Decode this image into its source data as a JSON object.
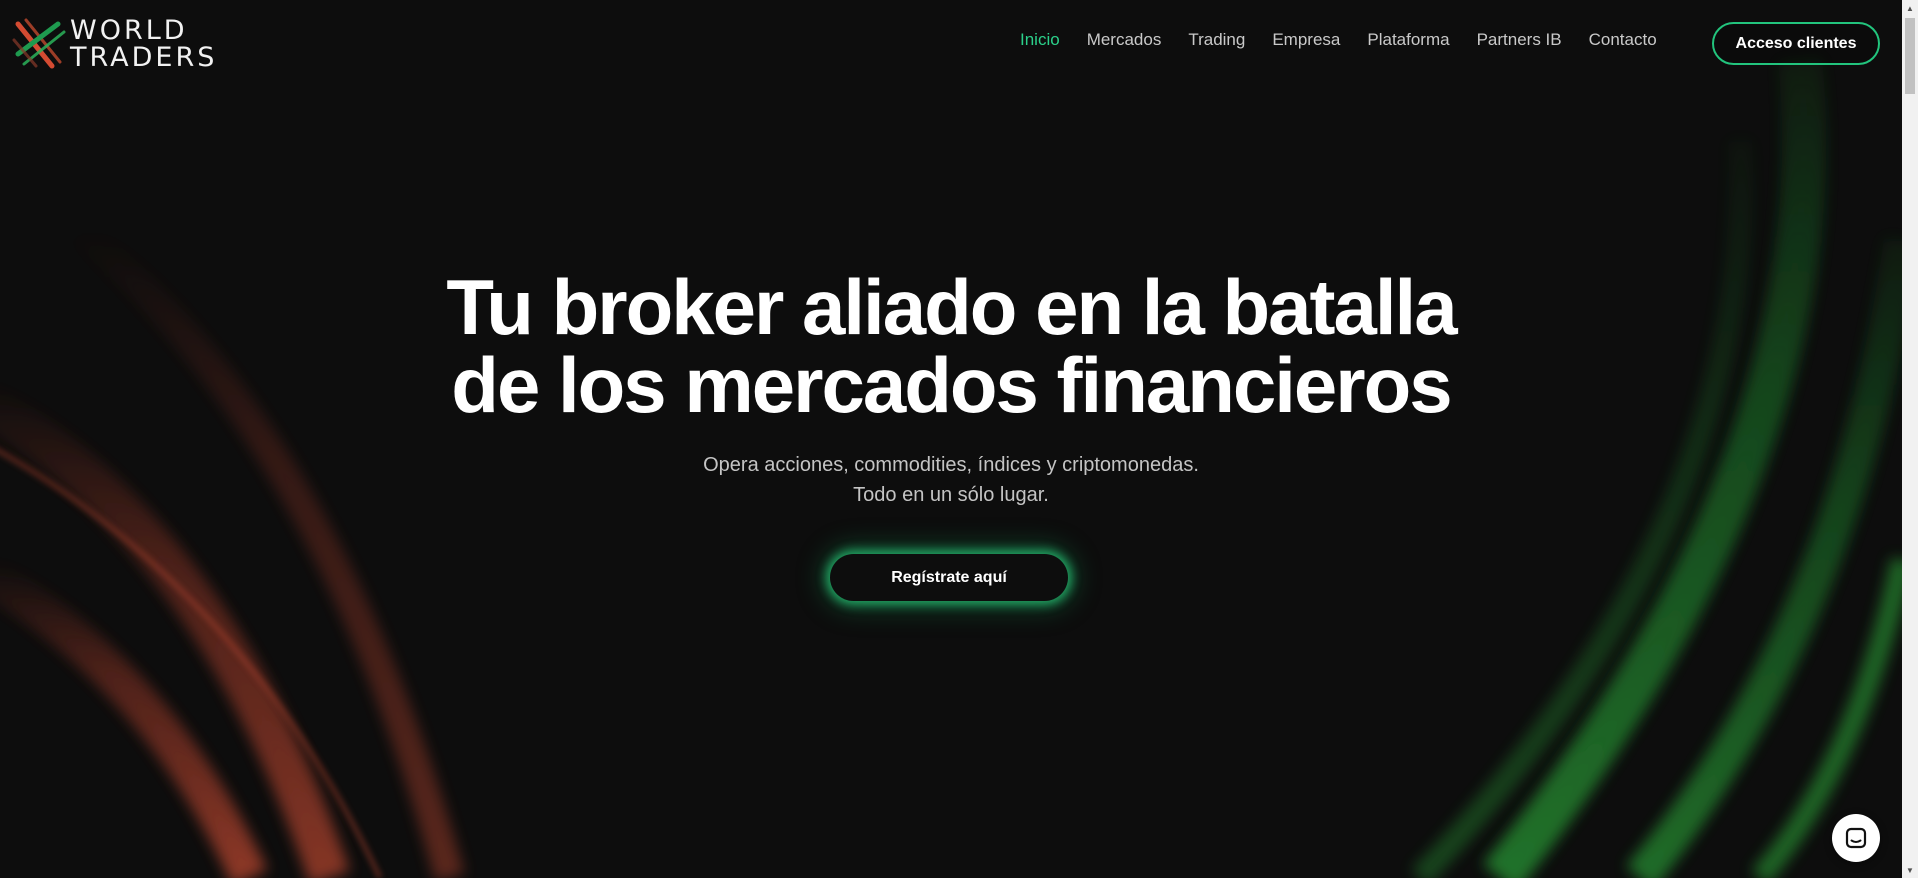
{
  "brand": {
    "line1": "WORLD",
    "line2": "TRADERS"
  },
  "nav": {
    "items": [
      {
        "label": "Inicio",
        "active": true
      },
      {
        "label": "Mercados"
      },
      {
        "label": "Trading"
      },
      {
        "label": "Empresa"
      },
      {
        "label": "Plataforma"
      },
      {
        "label": "Partners IB"
      },
      {
        "label": "Contacto"
      }
    ],
    "cta_label": "Acceso clientes"
  },
  "hero": {
    "title_line1": "Tu broker aliado en la batalla",
    "title_line2": "de los mercados financieros",
    "subtitle_line1": "Opera acciones, commodities, índices y criptomonedas.",
    "subtitle_line2": "Todo en un sólo lugar.",
    "cta_label": "Regístrate aquí"
  },
  "colors": {
    "accent_green": "#2bd08a",
    "background": "#0d0d0d",
    "arc_red": "#b8432e",
    "arc_green": "#1f8a2e"
  },
  "icons": {
    "logo": "world-traders-logo-icon",
    "chat": "chat-icon"
  }
}
